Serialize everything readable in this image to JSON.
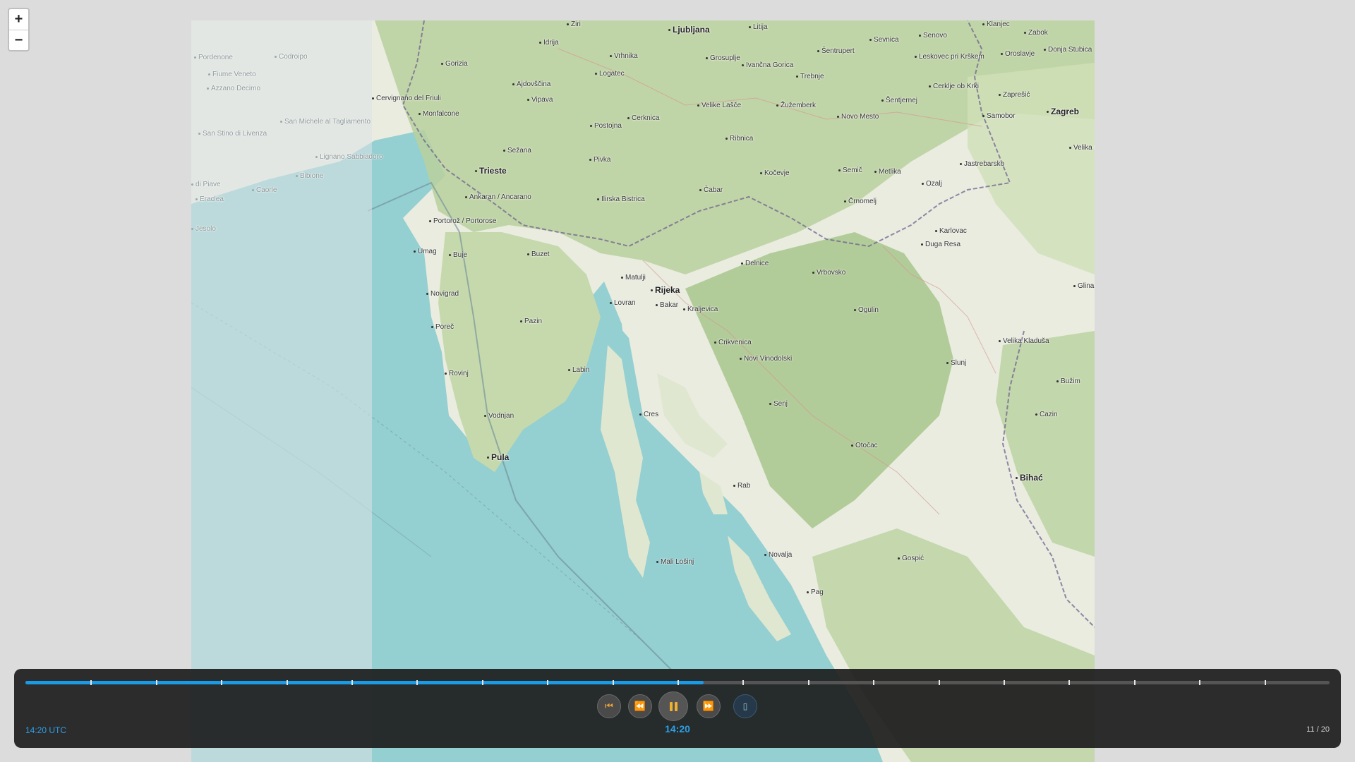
{
  "zoom": {
    "in_label": "+",
    "out_label": "−"
  },
  "map": {
    "colors": {
      "sea": "#94cfd1",
      "land_green": "#b5cf9a",
      "land_light": "#eef0e6",
      "border": "#6a5a8a"
    },
    "places": [
      {
        "name": "Ljubljana",
        "big": true
      },
      {
        "name": "Zagreb",
        "big": true
      },
      {
        "name": "Rijeka",
        "big": true
      },
      {
        "name": "Trieste",
        "big": true
      },
      {
        "name": "Pula",
        "big": true
      },
      {
        "name": "Bihać",
        "big": true
      },
      {
        "name": "Pordenone",
        "faint": true
      },
      {
        "name": "Codroipo",
        "faint": true
      },
      {
        "name": "Fiume Veneto",
        "faint": true
      },
      {
        "name": "Azzano Decimo",
        "faint": true
      },
      {
        "name": "San Michele al Tagliamento",
        "faint": true
      },
      {
        "name": "San Stino di Livenza",
        "faint": true
      },
      {
        "name": "Lignano Sabbiadoro",
        "faint": true
      },
      {
        "name": "Bibione",
        "faint": true
      },
      {
        "name": "Caorle",
        "faint": true
      },
      {
        "name": "di Piave",
        "faint": true
      },
      {
        "name": "Eraclea",
        "faint": true
      },
      {
        "name": "Jesolo",
        "faint": true
      },
      {
        "name": "Cervignano del Friuli"
      },
      {
        "name": "Monfalcone"
      },
      {
        "name": "Gorizia"
      },
      {
        "name": "Idrija"
      },
      {
        "name": "Žiri"
      },
      {
        "name": "Ajdovščina"
      },
      {
        "name": "Vipava"
      },
      {
        "name": "Vrhnika"
      },
      {
        "name": "Logatec"
      },
      {
        "name": "Grosuplje"
      },
      {
        "name": "Litija"
      },
      {
        "name": "Ivančna Gorica"
      },
      {
        "name": "Trebnje"
      },
      {
        "name": "Šentrupert"
      },
      {
        "name": "Sevnica"
      },
      {
        "name": "Senovo"
      },
      {
        "name": "Klanjec"
      },
      {
        "name": "Zabok"
      },
      {
        "name": "Oroslavje"
      },
      {
        "name": "Donja Stubica"
      },
      {
        "name": "Leskovec pri Krškem"
      },
      {
        "name": "Cerklje ob Krki"
      },
      {
        "name": "Zaprešić"
      },
      {
        "name": "Samobor"
      },
      {
        "name": "Šentjernej"
      },
      {
        "name": "Novo Mesto"
      },
      {
        "name": "Žužemberk"
      },
      {
        "name": "Velike Lašče"
      },
      {
        "name": "Cerknica"
      },
      {
        "name": "Postojna"
      },
      {
        "name": "Ribnica"
      },
      {
        "name": "Sežana"
      },
      {
        "name": "Pivka"
      },
      {
        "name": "Kočevje"
      },
      {
        "name": "Semič"
      },
      {
        "name": "Metlika"
      },
      {
        "name": "Jastrebarsko"
      },
      {
        "name": "Velika G"
      },
      {
        "name": "Ozalj"
      },
      {
        "name": "Črnomelj"
      },
      {
        "name": "Čabar"
      },
      {
        "name": "Ilirska Bistrica"
      },
      {
        "name": "Ankaran / Ancarano"
      },
      {
        "name": "Portorož / Portorose"
      },
      {
        "name": "Umag"
      },
      {
        "name": "Buje"
      },
      {
        "name": "Buzet"
      },
      {
        "name": "Karlovac"
      },
      {
        "name": "Duga Resa"
      },
      {
        "name": "Delnice"
      },
      {
        "name": "Vrbovsko"
      },
      {
        "name": "Glina"
      },
      {
        "name": "Matulji"
      },
      {
        "name": "Novigrad"
      },
      {
        "name": "Lovran"
      },
      {
        "name": "Bakar"
      },
      {
        "name": "Kraljevica"
      },
      {
        "name": "Ogulin"
      },
      {
        "name": "Poreč"
      },
      {
        "name": "Pazin"
      },
      {
        "name": "Crikvenica"
      },
      {
        "name": "Velika Kladuša"
      },
      {
        "name": "Novi Vinodolski"
      },
      {
        "name": "Slunj"
      },
      {
        "name": "Rovinj"
      },
      {
        "name": "Labin"
      },
      {
        "name": "Bužim"
      },
      {
        "name": "Senj"
      },
      {
        "name": "Cres"
      },
      {
        "name": "Vodnjan"
      },
      {
        "name": "Cazin"
      },
      {
        "name": "Otočac"
      },
      {
        "name": "Rab"
      },
      {
        "name": "Novalja"
      },
      {
        "name": "Gospić"
      },
      {
        "name": "Mali Lošinj"
      },
      {
        "name": "Pag"
      }
    ]
  },
  "player": {
    "progress": {
      "total_steps": 20,
      "current_step": 11
    },
    "buttons": {
      "first": "⏮",
      "prev": "⏪",
      "next": "⏩",
      "extra": "▯"
    },
    "time_label_left": "14:20 UTC",
    "time_label_center": "14:20",
    "counter": "11 / 20",
    "accent_color": "#1a9be8"
  }
}
